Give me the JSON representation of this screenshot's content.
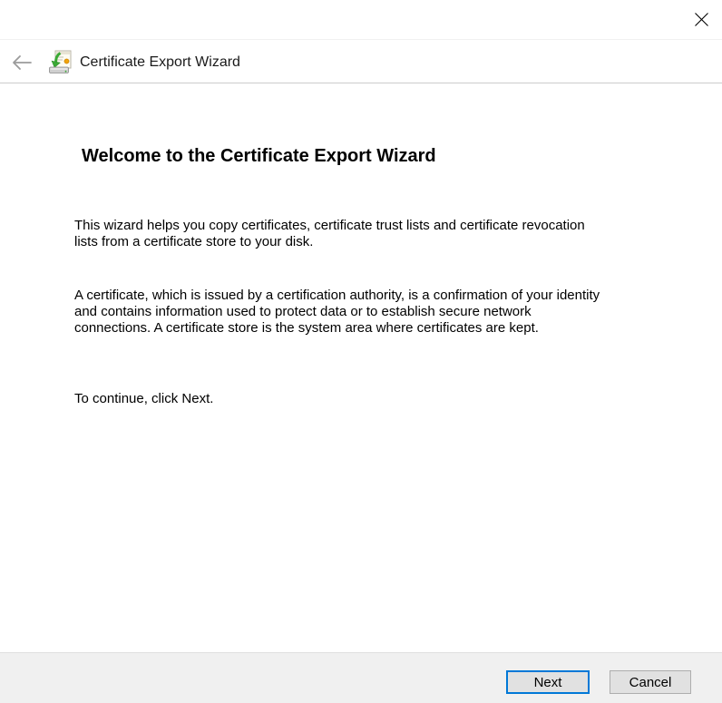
{
  "window": {
    "title": "Certificate Export Wizard"
  },
  "header": {
    "title": "Certificate Export Wizard",
    "icons": {
      "back": "back-arrow-icon",
      "app": "certificate-export-icon",
      "close": "close-icon"
    }
  },
  "content": {
    "heading": "Welcome to the Certificate Export Wizard",
    "paragraph1": "This wizard helps you copy certificates, certificate trust lists and certificate revocation\nlists from a certificate store to your disk.",
    "paragraph2": "A certificate, which is issued by a certification authority, is a confirmation of your identity\nand contains information used to protect data or to establish secure network\nconnections. A certificate store is the system area where certificates are kept.",
    "paragraph3": "To continue, click Next."
  },
  "footer": {
    "next_label": "Next",
    "cancel_label": "Cancel"
  },
  "colors": {
    "accent": "#0078d7",
    "footer_bg": "#f0f0f0",
    "button_bg": "#e1e1e1",
    "button_border": "#adadad",
    "header_divider": "#cccccc",
    "disabled_arrow": "#9b9b9b",
    "icon_green": "#3aa935",
    "icon_seal_orange": "#f0a30a"
  }
}
